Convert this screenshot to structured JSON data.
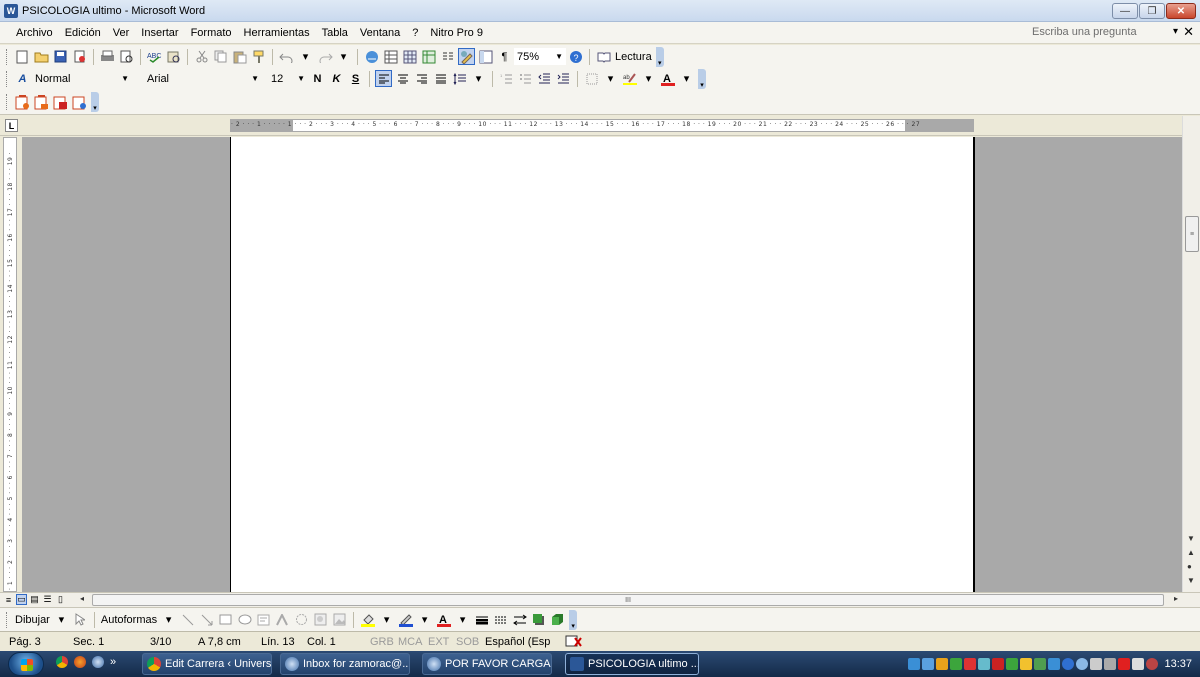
{
  "window": {
    "title": "PSICOLOGIA  ultimo - Microsoft Word",
    "app_icon": "W",
    "minimize_label": "—",
    "maximize_label": "❐",
    "close_label": "✕"
  },
  "menubar": {
    "items": [
      "Archivo",
      "Edición",
      "Ver",
      "Insertar",
      "Formato",
      "Herramientas",
      "Tabla",
      "Ventana",
      "?",
      "Nitro Pro 9"
    ],
    "ask_placeholder": "Escriba una pregunta",
    "ask_arrow": "▾",
    "close_doc": "✕"
  },
  "standard_toolbar": {
    "zoom": "75%",
    "reading_label": "Lectura",
    "paragraph_mark": "¶",
    "help_icon": "?"
  },
  "format_toolbar": {
    "style": "Normal",
    "font": "Arial",
    "size": "12",
    "bold": "N",
    "italic": "K",
    "underline": "S",
    "font_color_letter": "A",
    "style_icon_letter": "A"
  },
  "ruler": {
    "tab_selector": "L",
    "horizontal_ticks": "· 2 · · · 1 · · ·     · · 1 · · · 2 · · · 3 · · · 4 · · · 5 · · · 6 · · · 7 · · · 8 · · · 9 · · · 10 · · · 11 · · · 12 · · · 13 · · · 14 · · · 15 · · · 16 · · · 17 · · · 18 · · · 19 · · · 20 · · · 21 · · · 22 · · · 23 · · · 24 · · · 25 · · · 26 · · · 27",
    "vertical_ticks": "· 1 · · · 2 · · · 3 · · · 4 · · · 5 · · · 6 · · · 7 · · · 8 · · · 9 · · · 10 · · · 11 · · · 12 · · · 13 · · · 14 · · · 15 · · · 16 · · · 17 · · · 18 · · · 19 ·"
  },
  "scroll": {
    "h_thumb_grip": "III",
    "v_thumb_grip": "≡"
  },
  "drawing_toolbar": {
    "draw_label": "Dibujar",
    "autoshapes_label": "Autoformas"
  },
  "statusbar": {
    "page": "Pág. 3",
    "section": "Sec. 1",
    "page_of": "3/10",
    "at": "A 7,8 cm",
    "line": "Lín. 13",
    "col": "Col. 1",
    "grb": "GRB",
    "mca": "MCA",
    "ext": "EXT",
    "sob": "SOB",
    "language": "Español (Esp"
  },
  "taskbar": {
    "quick_overflow": "»",
    "tasks": [
      {
        "label": "Edit Carrera ‹ Univers...",
        "color": "#e8a21b"
      },
      {
        "label": "Inbox for zamorac@...",
        "color": "#c9d7ea"
      },
      {
        "label": "POR FAVOR CARGA...",
        "color": "#c9d7ea"
      },
      {
        "label": "PSICOLOGIA  ultimo ...",
        "color": "#2b5797"
      }
    ],
    "clock": "13:37"
  },
  "colors": {
    "page_background": "#ffffff",
    "workspace_gray": "#a9a9a9",
    "taskbar": "#1d3a63",
    "title_gradient_top": "#dfe9f5"
  }
}
